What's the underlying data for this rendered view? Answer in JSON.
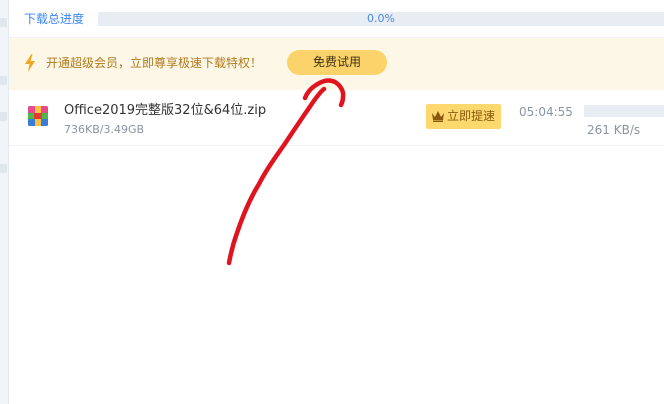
{
  "overall_progress": {
    "label": "下载总进度",
    "percent_text": "0.0%",
    "fraction": 0.0
  },
  "promo": {
    "icon": "lightning-icon",
    "text": "开通超级会员，立即尊享极速下载特权！",
    "button_label": "免费试用"
  },
  "task": {
    "file_icon": "winrar-archive-icon",
    "file_name": "Office2019完整版32位&64位.zip",
    "size_text": "736KB/3.49GB",
    "boost_icon": "crown-icon",
    "boost_label": "立即提速",
    "time_remaining": "05:04:55",
    "speed": "261 KB/s",
    "progress_fraction": 0.0002
  },
  "annotation": {
    "type": "hand-drawn-arrow",
    "color": "#e0141e",
    "points_to": "trial-button"
  },
  "colors": {
    "accent": "#3a86f5",
    "banner_background": "#fdf7e8",
    "vip_button": "#fbd36a",
    "annotation": "#e0141e"
  }
}
